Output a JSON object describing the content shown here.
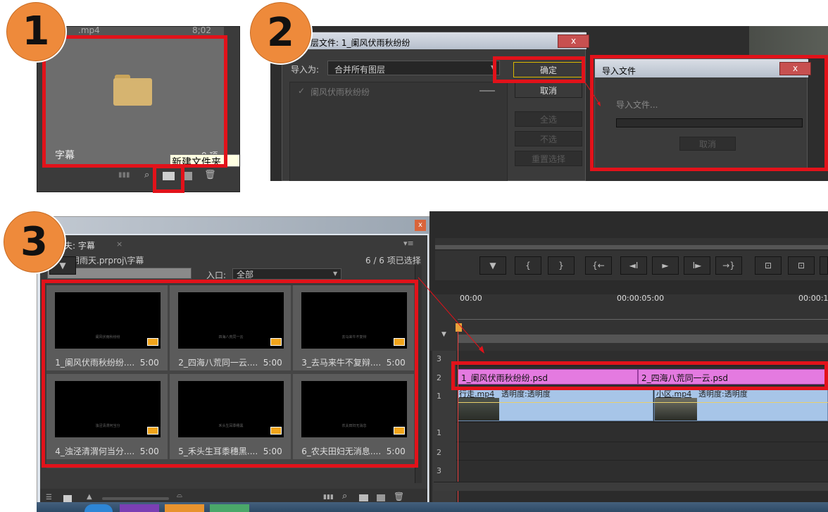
{
  "panel1": {
    "clip_name": ".mp4",
    "clip_duration": "8;02",
    "folder_name": "字幕",
    "folder_count": "0 项",
    "tooltip": "新建文件夹"
  },
  "panel2": {
    "dialog_title": "层文件: 1_阑风伏雨秋纷纷",
    "import_as_label": "导入为:",
    "import_as_value": "合并所有图层",
    "layer_item": "阑风伏雨秋纷纷",
    "ok_label": "确定",
    "cancel_label": "取消",
    "select_all_label": "全选",
    "select_none_label": "不选",
    "reset_label": "重置选择",
    "import_title": "导入文件",
    "import_status": "导入文件...",
    "import_cancel": "取消"
  },
  "panel3": {
    "tab_label": "夫: 字幕",
    "path": "阴雨天.prproj\\字幕",
    "selection": "6 / 6 项已选择",
    "entry_label": "入口:",
    "entry_value": "全部",
    "items": [
      {
        "name": "1_阑风伏雨秋纷纷....",
        "duration": "5:00",
        "caption": "阑风伏雨秋纷纷"
      },
      {
        "name": "2_四海八荒同一云....",
        "duration": "5:00",
        "caption": "四海八荒同一云"
      },
      {
        "name": "3_去马来牛不复辩....",
        "duration": "5:00",
        "caption": "去马来牛不复辩"
      },
      {
        "name": "4_浊泾清渭何当分....",
        "duration": "5:00",
        "caption": "浊泾清渭何当分"
      },
      {
        "name": "5_禾头生耳黍穗黑....",
        "duration": "5:00",
        "caption": "禾头生耳黍穗黑"
      },
      {
        "name": "6_农夫田妇无消息....",
        "duration": "5:00",
        "caption": "农夫田妇无消息"
      }
    ]
  },
  "timeline": {
    "time_start": "00:00",
    "time_mid": "00:00:05:00",
    "time_end": "00:00:1",
    "tracks_top": [
      "3",
      "2",
      "1"
    ],
    "tracks_audio": [
      "1",
      "2",
      "3"
    ],
    "clip_psd_1": "1_阑风伏雨秋纷纷.psd",
    "clip_psd_2": "2_四海八荒同一云.psd",
    "clip_video_1": "行走.mp4",
    "clip_video_1_fx": "透明度:透明度",
    "clip_video_2": "小区.mp4",
    "clip_video_2_fx": "透明度:透明度"
  },
  "badges": [
    "1",
    "2",
    "3"
  ]
}
